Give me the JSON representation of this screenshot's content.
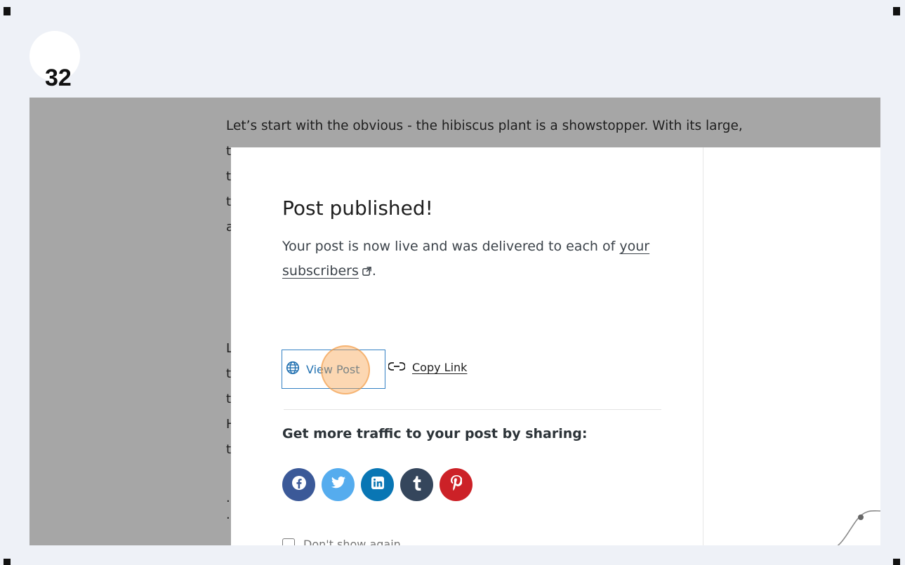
{
  "step": {
    "number": "32"
  },
  "background_article": {
    "first_line": "Let’s start with the obvious - the hibiscus plant is a showstopper. With its large,",
    "partial_chars": [
      "t",
      "t",
      "t",
      "a",
      "L",
      "t",
      "t",
      "H",
      "t",
      ".",
      "."
    ]
  },
  "modal": {
    "title": "Post published!",
    "message_prefix": "Your post is now live and was delivered to each of",
    "subscribers_link": "your subscribers",
    "message_suffix": ".",
    "view_post_label": "View Post",
    "copy_link_label": "Copy Link",
    "share_heading": "Get more traffic to your post by sharing:",
    "social_buttons": [
      {
        "name": "facebook",
        "icon": "facebook-icon",
        "color": "#3b5998"
      },
      {
        "name": "twitter",
        "icon": "twitter-icon",
        "color": "#55acee"
      },
      {
        "name": "linkedin",
        "icon": "linkedin-icon",
        "color": "#0976b4"
      },
      {
        "name": "tumblr",
        "icon": "tumblr-icon",
        "color": "#35465c"
      },
      {
        "name": "pinterest",
        "icon": "pinterest-icon",
        "color": "#cc2127"
      }
    ],
    "dont_show_label": "Don't show again",
    "dont_show_checked": false
  },
  "colors": {
    "accent": "#2271b1",
    "click_marker": "#f7a048",
    "overlay": "#a6a6a6"
  }
}
